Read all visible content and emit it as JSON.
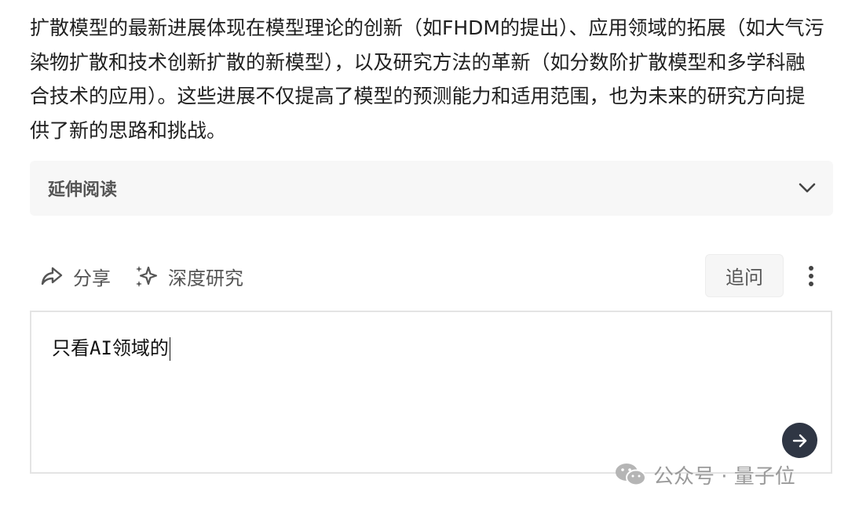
{
  "answer": {
    "paragraph": "扩散模型的最新进展体现在模型理论的创新（如FHDM的提出）、应用领域的拓展（如大气污染物扩散和技术创新扩散的新模型），以及研究方法的革新（如分数阶扩散模型和多学科融合技术的应用）。这些进展不仅提高了模型的预测能力和适用范围，也为未来的研究方向提供了新的思路和挑战。"
  },
  "extended_reading": {
    "title": "延伸阅读",
    "icon": "chevron-down-icon"
  },
  "actions": {
    "share_label": "分享",
    "share_icon": "share-icon",
    "deep_research_label": "深度研究",
    "deep_research_icon": "sparkle-icon",
    "followup_label": "追问",
    "more_icon": "more-vertical-icon"
  },
  "composer": {
    "input_value": "只看AI领域的",
    "send_icon": "arrow-right-icon"
  },
  "watermark": {
    "text": "公众号 · 量子位"
  },
  "colors": {
    "send_button": "#2f3644",
    "panel_bg": "#f7f7f7",
    "muted_text": "#555555"
  }
}
